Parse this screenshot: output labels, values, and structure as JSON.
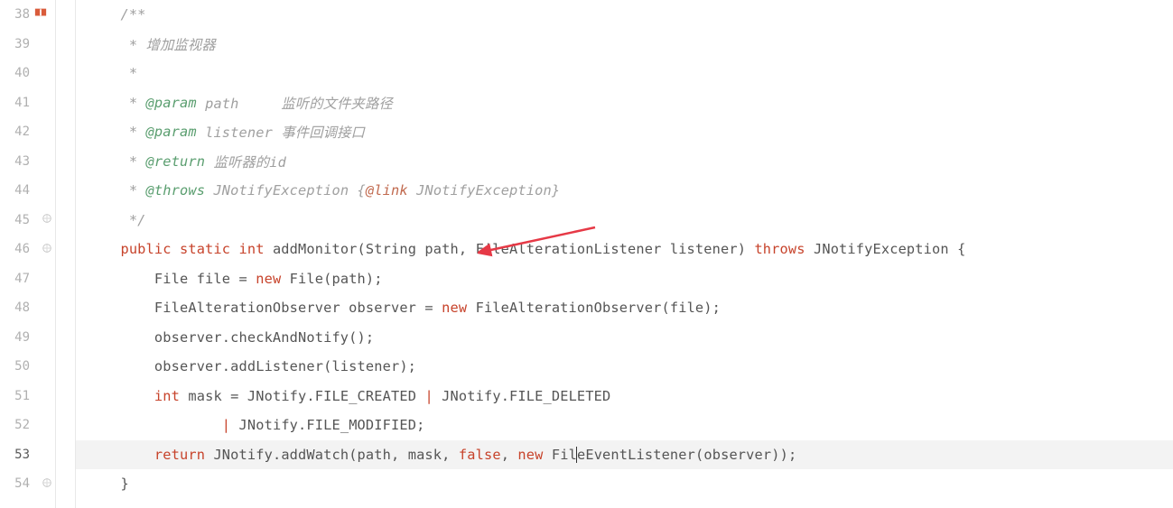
{
  "lines": [
    {
      "num": 38,
      "book_icon": true,
      "tokens": [
        {
          "cls": "tok-comment",
          "t": "/**"
        }
      ]
    },
    {
      "num": 39,
      "tokens": [
        {
          "cls": "tok-comment",
          "t": " * 增加监视器"
        }
      ]
    },
    {
      "num": 40,
      "tokens": [
        {
          "cls": "tok-comment",
          "t": " *"
        }
      ]
    },
    {
      "num": 41,
      "tokens": [
        {
          "cls": "tok-comment",
          "t": " * "
        },
        {
          "cls": "tok-doctag",
          "t": "@param"
        },
        {
          "cls": "tok-comment",
          "t": " path     监听的文件夹路径"
        }
      ]
    },
    {
      "num": 42,
      "tokens": [
        {
          "cls": "tok-comment",
          "t": " * "
        },
        {
          "cls": "tok-doctag",
          "t": "@param"
        },
        {
          "cls": "tok-comment",
          "t": " listener 事件回调接口"
        }
      ]
    },
    {
      "num": 43,
      "tokens": [
        {
          "cls": "tok-comment",
          "t": " * "
        },
        {
          "cls": "tok-doctag",
          "t": "@return"
        },
        {
          "cls": "tok-comment",
          "t": " 监听器的id"
        }
      ]
    },
    {
      "num": 44,
      "tokens": [
        {
          "cls": "tok-comment",
          "t": " * "
        },
        {
          "cls": "tok-doctag",
          "t": "@throws"
        },
        {
          "cls": "tok-comment",
          "t": " JNotifyException {"
        },
        {
          "cls": "tok-link",
          "t": "@link"
        },
        {
          "cls": "tok-comment",
          "t": " JNotifyException}"
        }
      ]
    },
    {
      "num": 45,
      "fold": true,
      "tokens": [
        {
          "cls": "tok-comment",
          "t": " */"
        }
      ]
    },
    {
      "num": 46,
      "fold": true,
      "tokens": [
        {
          "cls": "tok-keyword",
          "t": "public static int"
        },
        {
          "cls": "tok-default",
          "t": " addMonitor(String path, FileAlterationListener listener) "
        },
        {
          "cls": "tok-keyword",
          "t": "throws"
        },
        {
          "cls": "tok-default",
          "t": " JNotifyException {"
        }
      ]
    },
    {
      "num": 47,
      "tokens": [
        {
          "cls": "tok-default",
          "t": "    File file = "
        },
        {
          "cls": "tok-keyword",
          "t": "new"
        },
        {
          "cls": "tok-default",
          "t": " File(path);"
        }
      ]
    },
    {
      "num": 48,
      "tokens": [
        {
          "cls": "tok-default",
          "t": "    FileAlterationObserver observer = "
        },
        {
          "cls": "tok-keyword",
          "t": "new"
        },
        {
          "cls": "tok-default",
          "t": " FileAlterationObserver(file);"
        }
      ]
    },
    {
      "num": 49,
      "tokens": [
        {
          "cls": "tok-default",
          "t": "    observer.checkAndNotify();"
        }
      ]
    },
    {
      "num": 50,
      "tokens": [
        {
          "cls": "tok-default",
          "t": "    observer.addListener(listener);"
        }
      ]
    },
    {
      "num": 51,
      "tokens": [
        {
          "cls": "tok-default",
          "t": "    "
        },
        {
          "cls": "tok-keyword",
          "t": "int"
        },
        {
          "cls": "tok-default",
          "t": " mask = JNotify.FILE_CREATED "
        },
        {
          "cls": "tok-operator",
          "t": "|"
        },
        {
          "cls": "tok-default",
          "t": " JNotify.FILE_DELETED"
        }
      ]
    },
    {
      "num": 52,
      "tokens": [
        {
          "cls": "tok-default",
          "t": "            "
        },
        {
          "cls": "tok-operator",
          "t": "|"
        },
        {
          "cls": "tok-default",
          "t": " JNotify.FILE_MODIFIED;"
        }
      ]
    },
    {
      "num": 53,
      "highlighted": true,
      "caret_after": 5,
      "tokens": [
        {
          "cls": "tok-default",
          "t": "    "
        },
        {
          "cls": "tok-keyword",
          "t": "return"
        },
        {
          "cls": "tok-default",
          "t": " JNotify.addWatch(path, mask, "
        },
        {
          "cls": "tok-keyword",
          "t": "false"
        },
        {
          "cls": "tok-default",
          "t": ", "
        },
        {
          "cls": "tok-keyword",
          "t": "new"
        },
        {
          "cls": "tok-default",
          "t": " Fil"
        },
        {
          "cls": "caret-marker",
          "t": ""
        },
        {
          "cls": "tok-default",
          "t": "eEventListener(observer));"
        }
      ]
    },
    {
      "num": 54,
      "fold": true,
      "tokens": [
        {
          "cls": "tok-default",
          "t": "}"
        }
      ]
    }
  ],
  "indent_prefix": "    ",
  "annotation": {
    "type": "arrow",
    "color": "#e63946"
  }
}
